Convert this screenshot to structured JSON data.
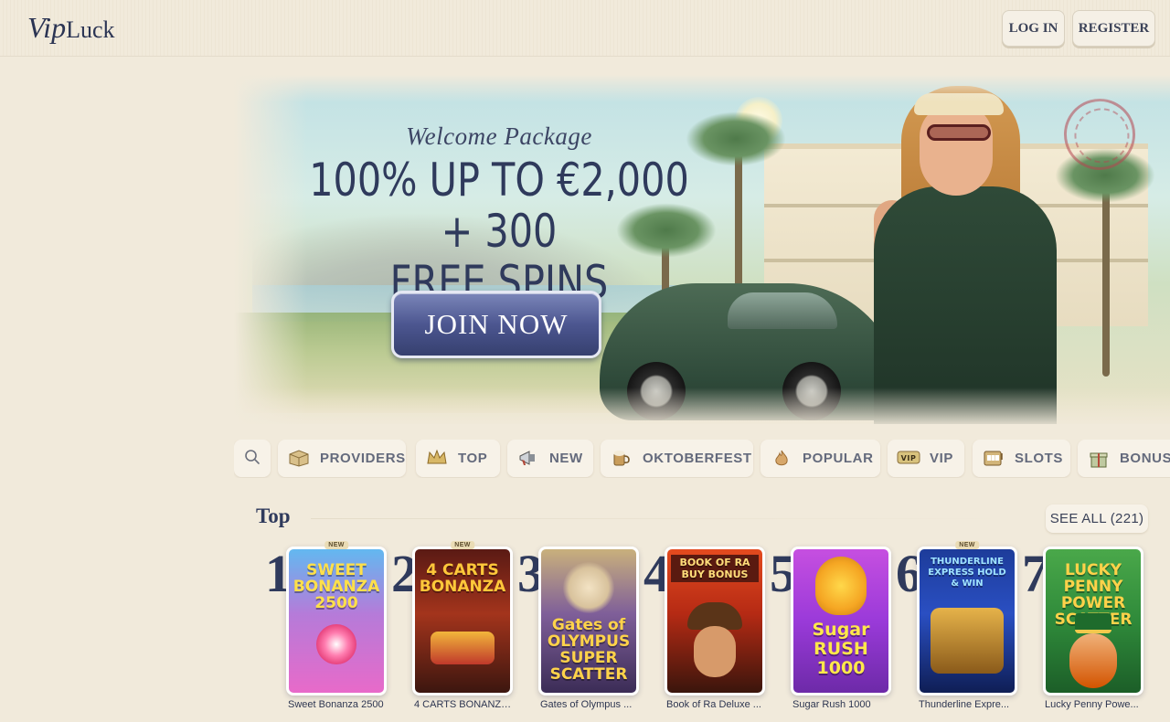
{
  "header": {
    "logo_vip": "Vip",
    "logo_luck": "Luck",
    "login_label": "LOG IN",
    "register_label": "REGISTER"
  },
  "hero": {
    "welcome": "Welcome Package",
    "headline_line1": "100% UP TO €2,000 + 300",
    "headline_line2": "FREE SPINS",
    "cta_label": "JOIN NOW"
  },
  "categories": [
    {
      "label": "PROVIDERS",
      "icon": "box-icon"
    },
    {
      "label": "TOP",
      "icon": "crown-icon"
    },
    {
      "label": "NEW",
      "icon": "megaphone-icon"
    },
    {
      "label": "OKTOBERFEST",
      "icon": "beer-icon"
    },
    {
      "label": "POPULAR",
      "icon": "flame-icon"
    },
    {
      "label": "VIP",
      "icon": "vip-icon"
    },
    {
      "label": "SLOTS",
      "icon": "slot-machine-icon"
    },
    {
      "label": "BONUS",
      "icon": "gift-icon"
    }
  ],
  "top_section": {
    "title": "Top",
    "see_all_label": "SEE ALL (221)"
  },
  "games": [
    {
      "rank": "1",
      "name": "Sweet Bonanza 2500",
      "art": "SWEET BONANZA 2500",
      "badge": "NEW"
    },
    {
      "rank": "2",
      "name": "4 CARTS BONANZA...",
      "art": "4 CARTS BONANZA",
      "badge": "NEW"
    },
    {
      "rank": "3",
      "name": "Gates of Olympus ...",
      "art": "Gates of OLYMPUS SUPER SCATTER",
      "badge": ""
    },
    {
      "rank": "4",
      "name": "Book of Ra Deluxe ...",
      "art": "BOOK OF RA BUY BONUS",
      "badge": ""
    },
    {
      "rank": "5",
      "name": "Sugar Rush 1000",
      "art": "Sugar RUSH 1000",
      "badge": ""
    },
    {
      "rank": "6",
      "name": "Thunderline Expre...",
      "art": "THUNDERLINE EXPRESS HOLD & WIN",
      "badge": "NEW"
    },
    {
      "rank": "7",
      "name": "Lucky Penny Powe...",
      "art": "LUCKY PENNY POWER SCATTER",
      "badge": ""
    }
  ],
  "colors": {
    "background": "#f1eadb",
    "brand_navy": "#2f3a5c",
    "cta_blue": "#4c5690"
  }
}
